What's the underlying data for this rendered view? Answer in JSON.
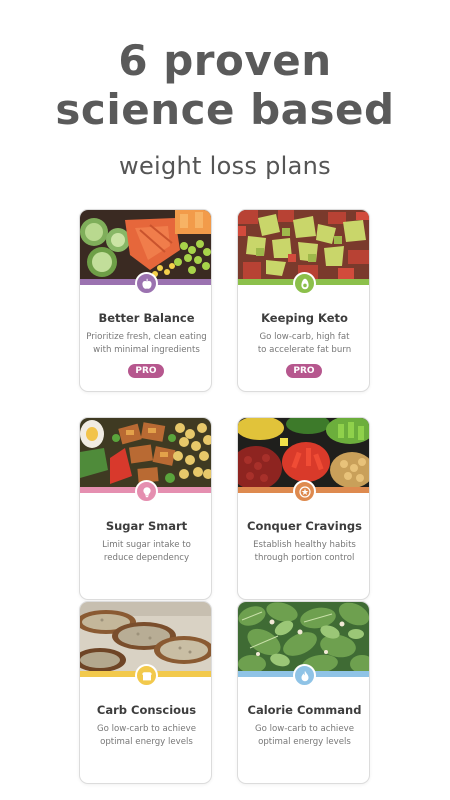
{
  "header": {
    "line1": "6 proven",
    "line2": "science based",
    "subtitle": "weight loss plans"
  },
  "plans": [
    {
      "title": "Better Balance",
      "desc1": "Prioritize fresh, clean eating",
      "desc2": "with minimal ingredients",
      "badge": "PRO",
      "icon": "apple-icon",
      "color": "#9b72b0"
    },
    {
      "title": "Keeping Keto",
      "desc1": "Go low-carb, high fat",
      "desc2": "to accelerate fat burn",
      "badge": "PRO",
      "icon": "avocado-icon",
      "color": "#8cc04b"
    },
    {
      "title": "Sugar Smart",
      "desc1": "Limit sugar intake to",
      "desc2": "reduce dependency",
      "badge": "",
      "icon": "lightbulb-icon",
      "color": "#e58fb0"
    },
    {
      "title": "Conquer Cravings",
      "desc1": "Establish healthy habits",
      "desc2": "through portion control",
      "badge": "",
      "icon": "star-icon",
      "color": "#de8a4f"
    },
    {
      "title": "Carb Conscious",
      "desc1": "Go low-carb to achieve",
      "desc2": "optimal energy levels",
      "badge": "",
      "icon": "bread-icon",
      "color": "#f2c94c"
    },
    {
      "title": "Calorie Command",
      "desc1": "Go low-carb to achieve",
      "desc2": "optimal energy levels",
      "badge": "",
      "icon": "flame-icon",
      "color": "#8fc3e6"
    }
  ]
}
